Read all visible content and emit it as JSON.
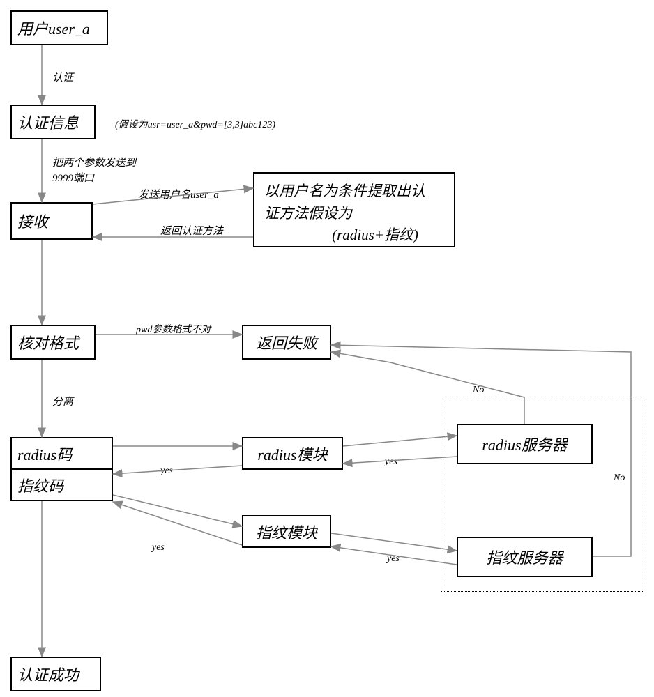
{
  "nodes": {
    "user": "用户user_a",
    "authinfo": "认证信息",
    "authinfo_note": "(假设为usr=user_a&pwd=[3,3]abc123)",
    "receive": "接收",
    "extract_l1": "以用户名为条件提取出认",
    "extract_l2": "证方法假设为",
    "extract_l3": "(radius+指纹)",
    "check": "核对格式",
    "fail": "返回失败",
    "radiuscode": "radius码",
    "fpcode": "指纹码",
    "radiusmod": "radius模块",
    "fpmod": "指纹模块",
    "radiussrv": "radius服务器",
    "fpsrv": "指纹服务器",
    "success": "认证成功"
  },
  "edges": {
    "auth": "认证",
    "send9999_l1": "把两个参数发送到",
    "send9999_l2": "9999端口",
    "send_user": "发送用户名user_a",
    "ret_method": "返回认证方法",
    "pwd_bad": "pwd参数格式不对",
    "split": "分离",
    "yes1": "yes",
    "yes2": "yes",
    "yes3": "yes",
    "yes4": "yes",
    "no1": "No",
    "no2": "No"
  }
}
